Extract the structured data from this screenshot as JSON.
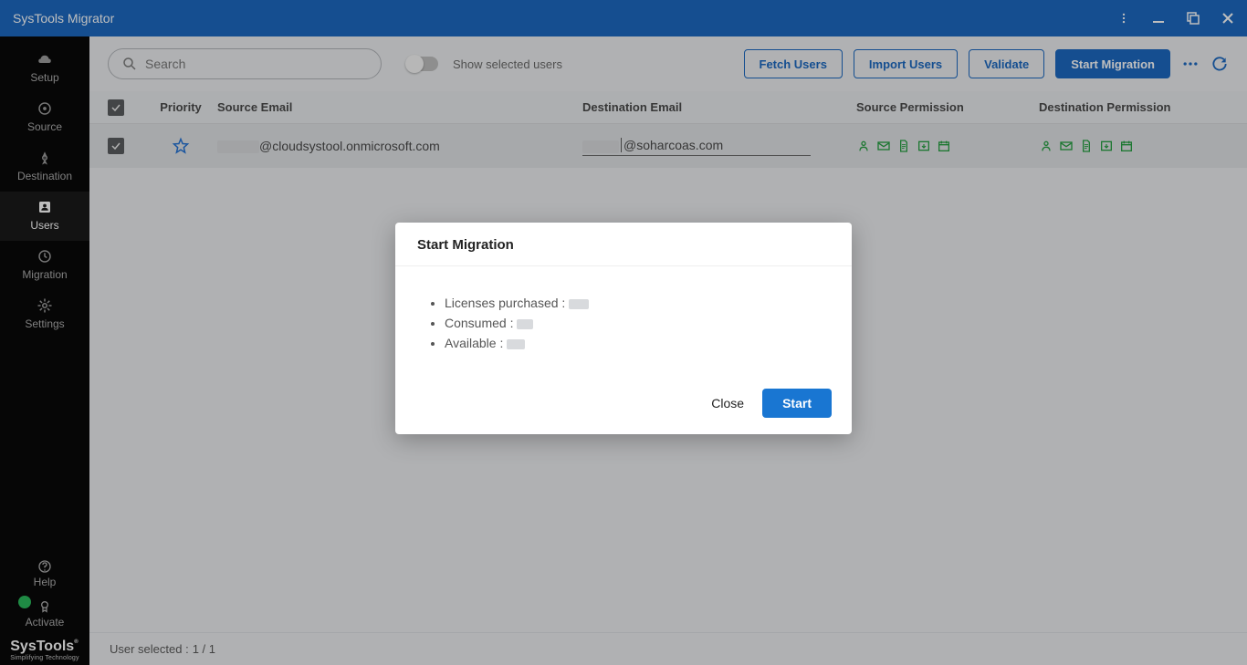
{
  "app_title": "SysTools Migrator",
  "sidebar": {
    "items": [
      {
        "label": "Setup"
      },
      {
        "label": "Source"
      },
      {
        "label": "Destination"
      },
      {
        "label": "Users"
      },
      {
        "label": "Migration"
      },
      {
        "label": "Settings"
      }
    ],
    "help_label": "Help",
    "activate_label": "Activate",
    "brand": "SysTools",
    "brand_tag": "Simplifying Technology"
  },
  "toolbar": {
    "search_placeholder": "Search",
    "toggle_label": "Show selected users",
    "fetch_label": "Fetch Users",
    "import_label": "Import Users",
    "validate_label": "Validate",
    "start_label": "Start Migration"
  },
  "table": {
    "headers": {
      "priority": "Priority",
      "source_email": "Source Email",
      "dest_email": "Destination Email",
      "source_perm": "Source Permission",
      "dest_perm": "Destination Permission"
    },
    "rows": [
      {
        "source_email_domain": "@cloudsystool.onmicrosoft.com",
        "dest_email_domain": "@soharcoas.com"
      }
    ]
  },
  "status": {
    "user_selected_label": "User selected :",
    "user_selected_value": "1 / 1"
  },
  "modal": {
    "title": "Start Migration",
    "licenses_label": "Licenses purchased :",
    "consumed_label": "Consumed :",
    "available_label": "Available :",
    "close_label": "Close",
    "start_label": "Start"
  }
}
